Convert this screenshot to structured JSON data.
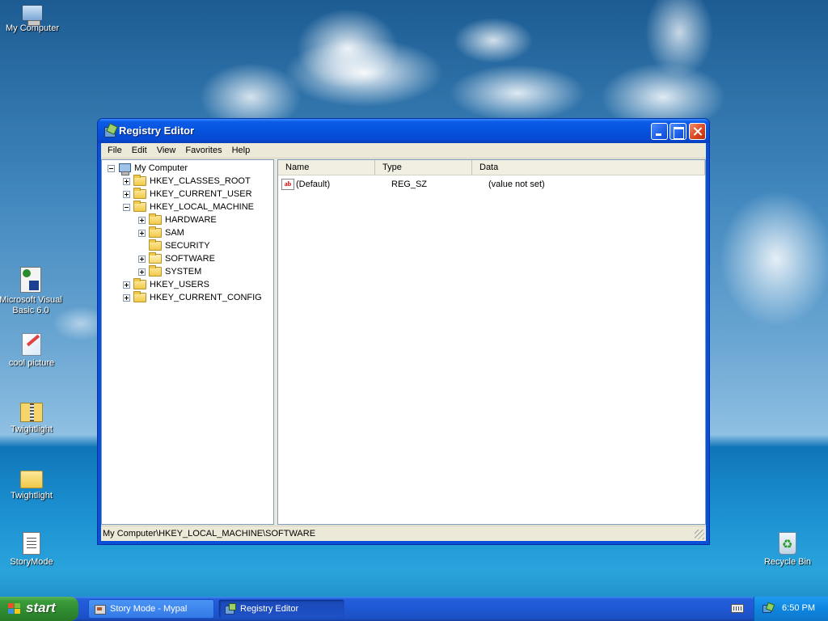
{
  "desktop": {
    "icons": [
      {
        "label": "My Computer",
        "icon": "computer-icon"
      },
      {
        "label": "Microsoft Visual Basic 6.0",
        "icon": "visual-basic-icon"
      },
      {
        "label": "cool picture",
        "icon": "picture-icon"
      },
      {
        "label": "Twightlight",
        "icon": "zip-folder-icon"
      },
      {
        "label": "Twightlight",
        "icon": "folder-icon"
      },
      {
        "label": "StoryMode",
        "icon": "text-document-icon"
      },
      {
        "label": "Recycle Bin",
        "icon": "recycle-bin-icon"
      }
    ]
  },
  "window": {
    "title": "Registry Editor",
    "menu": [
      "File",
      "Edit",
      "View",
      "Favorites",
      "Help"
    ],
    "tree": {
      "root": "My Computer",
      "hkcr": "HKEY_CLASSES_ROOT",
      "hkcu": "HKEY_CURRENT_USER",
      "hklm": "HKEY_LOCAL_MACHINE",
      "hardware": "HARDWARE",
      "sam": "SAM",
      "security": "SECURITY",
      "software": "SOFTWARE",
      "system": "SYSTEM",
      "hku": "HKEY_USERS",
      "hkcc": "HKEY_CURRENT_CONFIG"
    },
    "columns": {
      "name": "Name",
      "type": "Type",
      "data": "Data"
    },
    "values": [
      {
        "name": "(Default)",
        "type": "REG_SZ",
        "data": "(value not set)"
      }
    ],
    "status": "My Computer\\HKEY_LOCAL_MACHINE\\SOFTWARE"
  },
  "taskbar": {
    "start_label": "start",
    "tasks": [
      {
        "label": "Story Mode - Mypal",
        "active": false
      },
      {
        "label": "Registry Editor",
        "active": true
      }
    ],
    "clock": "6:50 PM"
  }
}
